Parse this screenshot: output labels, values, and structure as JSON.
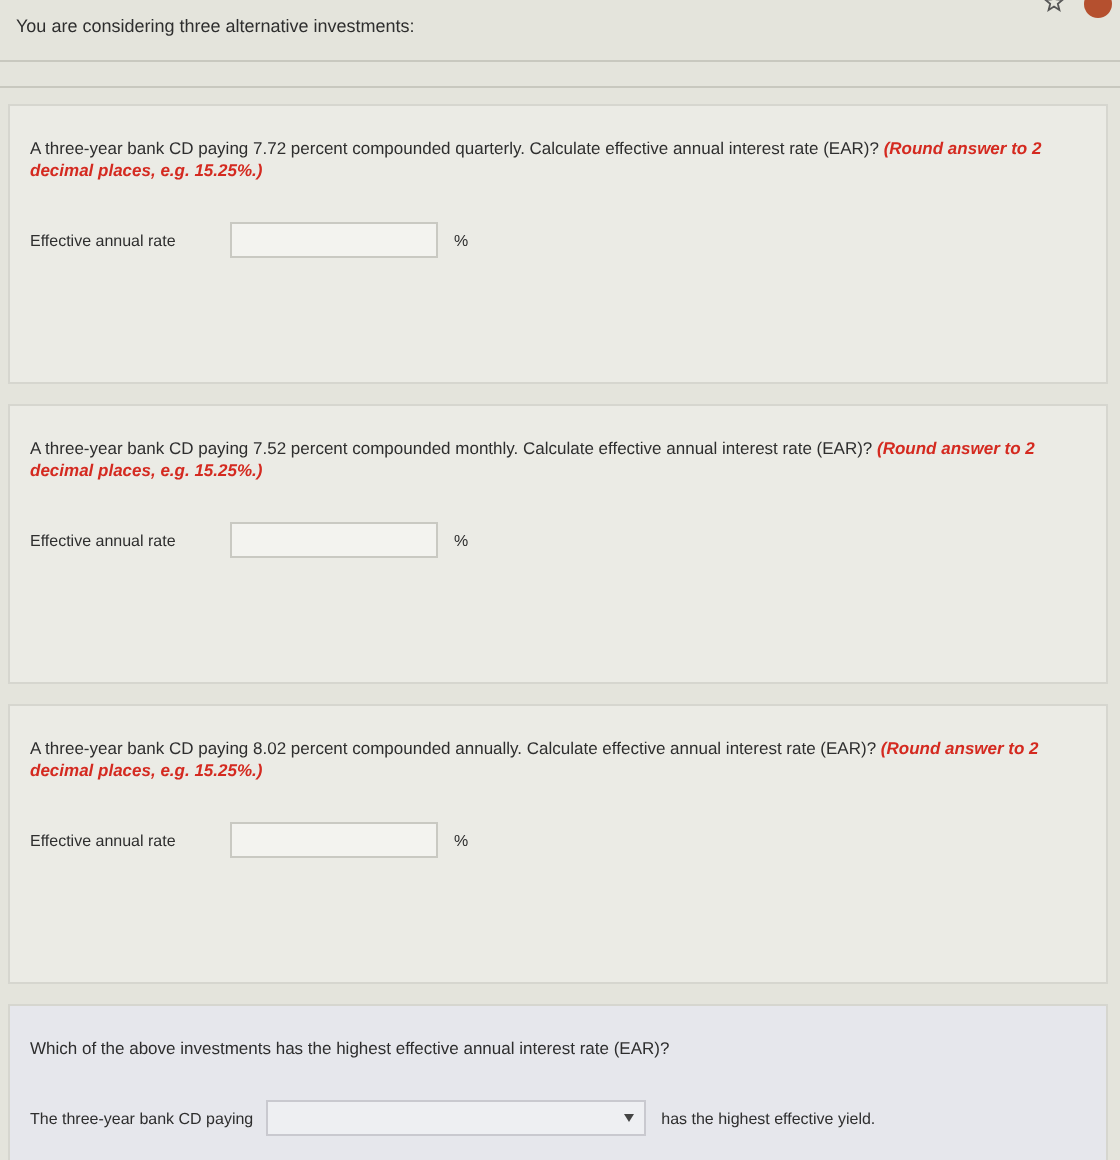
{
  "intro": "You are considering three alternative investments:",
  "questions": [
    {
      "text": "A three-year bank CD paying 7.72 percent compounded quarterly. Calculate effective annual interest rate (EAR)?",
      "hint": "(Round answer to 2 decimal places, e.g. 15.25%.)",
      "label": "Effective annual rate",
      "unit": "%"
    },
    {
      "text": "A three-year bank CD paying 7.52 percent compounded monthly. Calculate effective annual interest rate (EAR)?",
      "hint": "(Round answer to 2 decimal places, e.g. 15.25%.)",
      "label": "Effective annual rate",
      "unit": "%"
    },
    {
      "text": "A three-year bank CD paying 8.02 percent compounded annually. Calculate effective annual interest rate (EAR)?",
      "hint": "(Round answer to 2 decimal places, e.g. 15.25%.)",
      "label": "Effective annual rate",
      "unit": "%"
    }
  ],
  "final": {
    "text": "Which of the above investments has the highest effective annual interest rate (EAR)?",
    "before": "The three-year bank CD paying",
    "after": "has the highest effective yield."
  }
}
